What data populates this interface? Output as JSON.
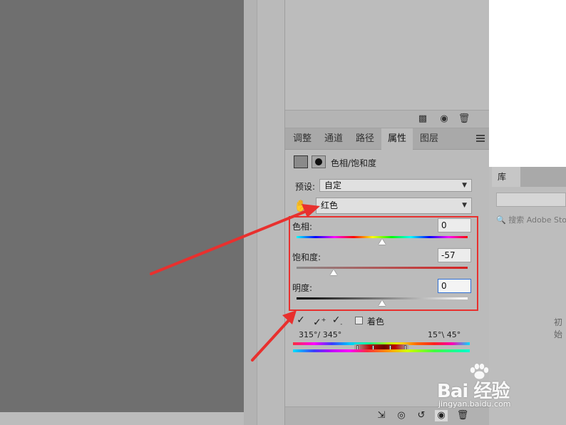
{
  "tabs": [
    "调整",
    "通道",
    "路径",
    "属性",
    "图层"
  ],
  "active_tab": "属性",
  "properties": {
    "title": "色相/饱和度",
    "preset_label": "预设:",
    "preset_value": "自定",
    "channel_value": "红色",
    "hue_label": "色相:",
    "hue_value": "0",
    "saturation_label": "饱和度:",
    "saturation_value": "-57",
    "lightness_label": "明度:",
    "lightness_value": "0",
    "colorize_label": "着色",
    "range_left": "315°/ 345°",
    "range_right": "15°\\ 45°"
  },
  "sliders": {
    "hue": {
      "value": 0,
      "min": -180,
      "max": 180
    },
    "saturation": {
      "value": -57,
      "min": -100,
      "max": 100
    },
    "lightness": {
      "value": 0,
      "min": -100,
      "max": 100
    }
  },
  "library": {
    "tab_label": "库",
    "search_placeholder": "搜索 Adobe Stock",
    "partial_text": "初始"
  },
  "watermark": {
    "brand": "Bai 经验",
    "url": "jingyan.baidu.com"
  },
  "colors": {
    "annotation_red": "#e8302e",
    "focus_blue": "#2f6fd4"
  }
}
